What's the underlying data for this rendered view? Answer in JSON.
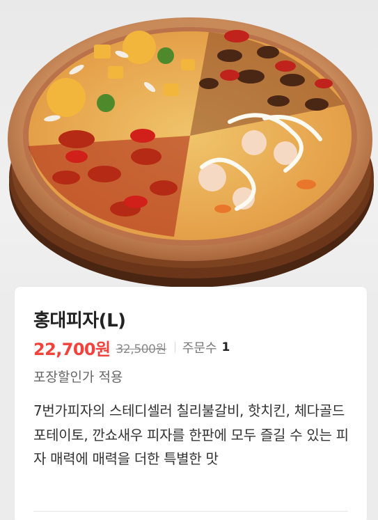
{
  "product": {
    "name": "홍대피자(L)",
    "sale_price": "22,700원",
    "original_price": "32,500원",
    "order_label": "주문수",
    "order_count": "1",
    "discount_note": "포장할인가 적용",
    "description": "7번가피자의 스테디셀러 칠리불갈비, 핫치킨, 체다골드 포테이토, 깐쇼새우 피자를 한판에 모두 즐길 수 있는 피자 매력에 매력을 더한 특별한 맛"
  },
  "colors": {
    "sale_price": "#f1423b",
    "title": "#222222",
    "background": "#ececec",
    "card": "#ffffff"
  },
  "hero_image": {
    "icon": "pizza-photo"
  }
}
